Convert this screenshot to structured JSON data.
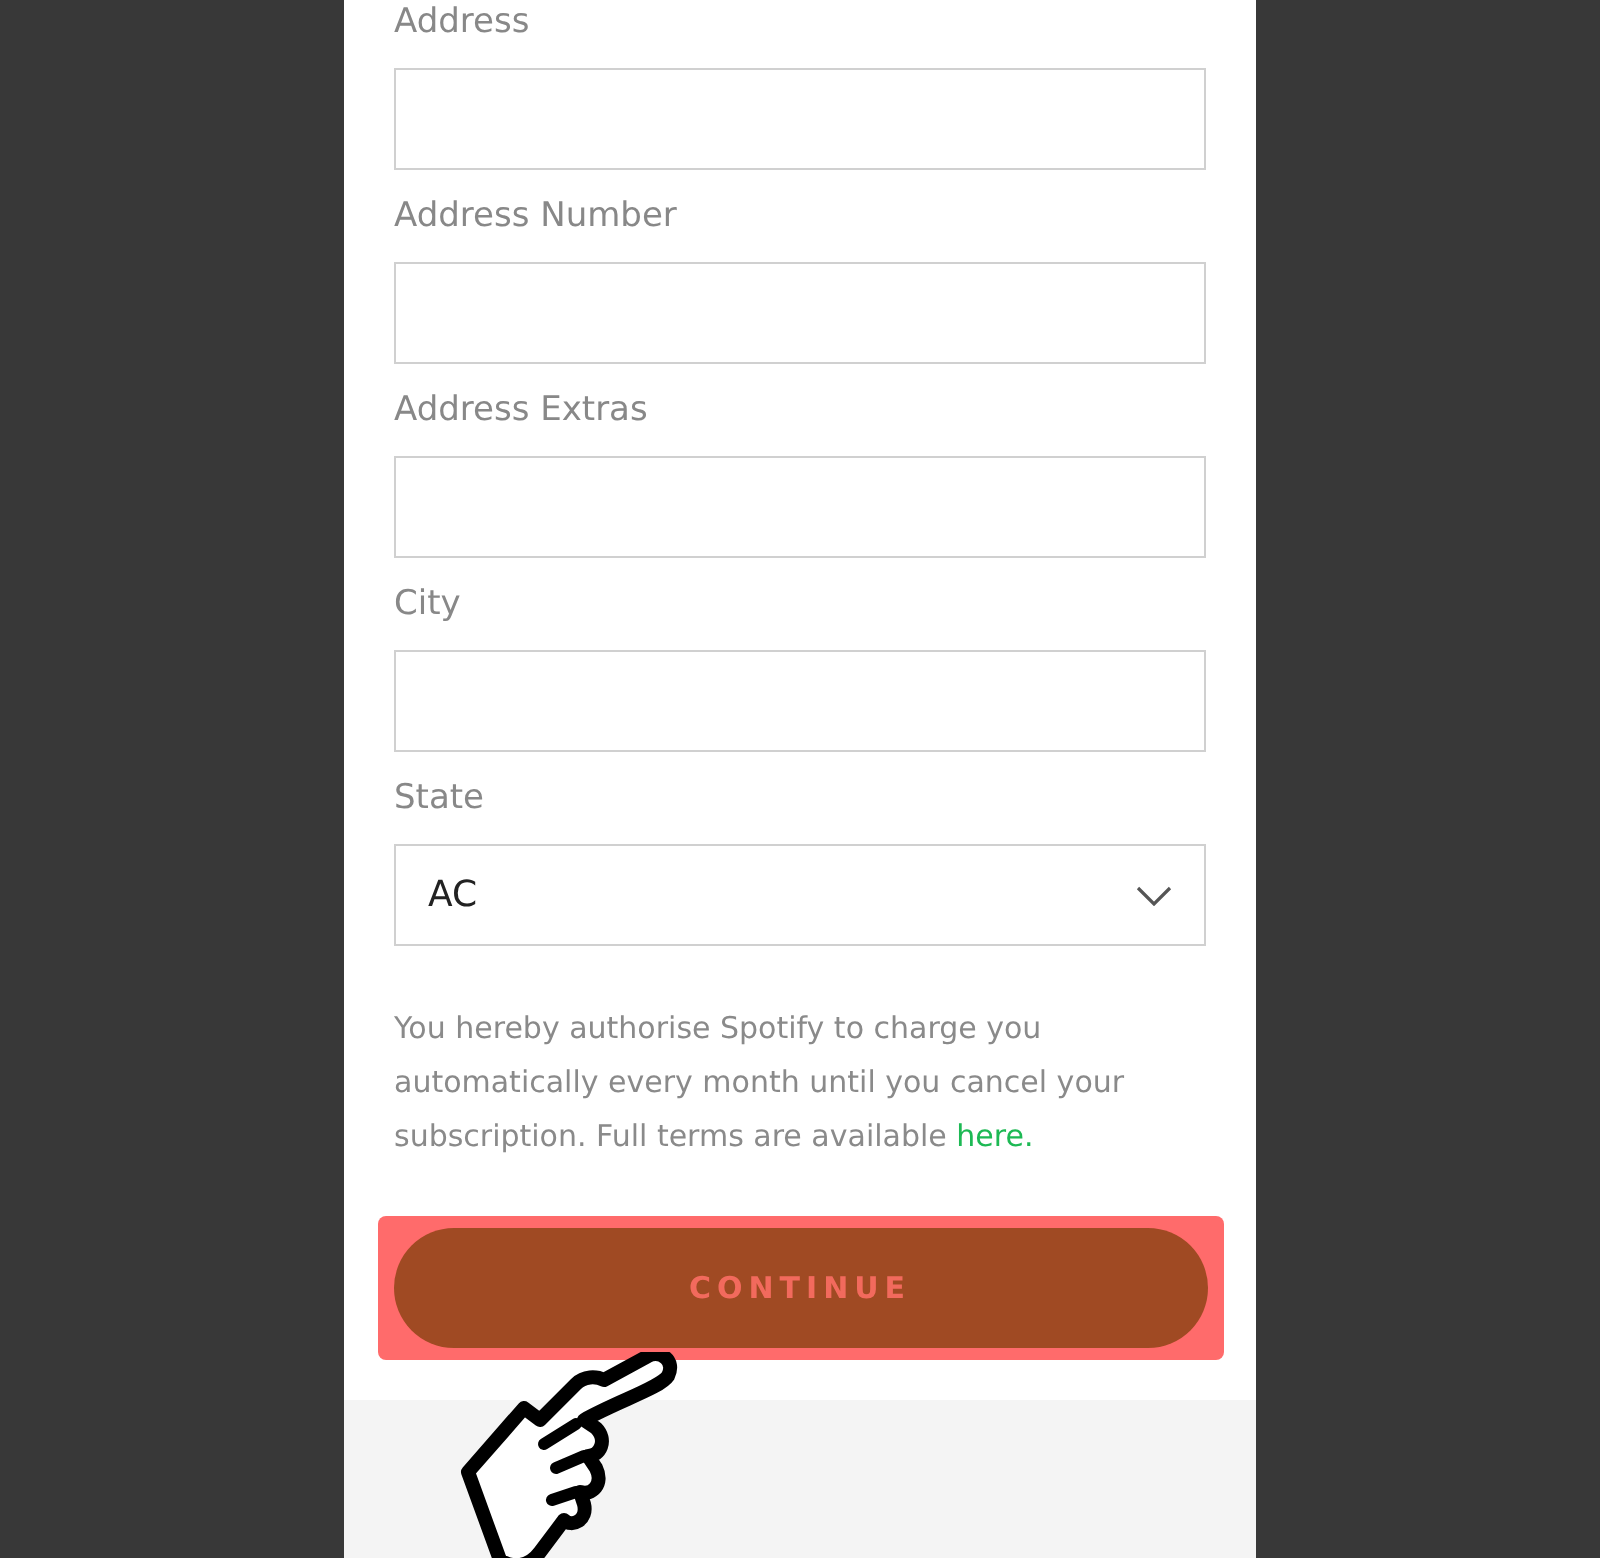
{
  "form": {
    "fields": [
      {
        "label": "Address",
        "kind": "text"
      },
      {
        "label": "Address Number",
        "kind": "text"
      },
      {
        "label": "Address Extras",
        "kind": "text"
      },
      {
        "label": "City",
        "kind": "text"
      },
      {
        "label": "State",
        "kind": "select",
        "value": "AC"
      }
    ],
    "terms": {
      "text": "You hereby authorise Spotify to charge you automatically every month until you cancel your subscription. Full terms are available ",
      "link": "here."
    },
    "button": {
      "label": "CONTINUE",
      "highlighted": true
    }
  }
}
